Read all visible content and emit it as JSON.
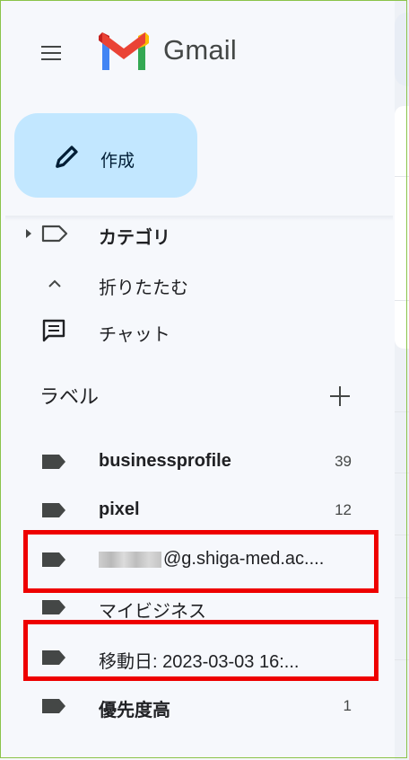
{
  "app": {
    "name": "Gmail"
  },
  "compose": {
    "label": "作成"
  },
  "nav": {
    "categories": "カテゴリ",
    "collapse": "折りたたむ",
    "chat": "チャット"
  },
  "labels_section": {
    "title": "ラベル"
  },
  "labels": [
    {
      "name": "businessprofile",
      "count": "39",
      "bold": true
    },
    {
      "name": "pixel",
      "count": "12",
      "bold": true
    },
    {
      "name": "@g.shiga-med.ac....",
      "count": "",
      "bold": false
    },
    {
      "name": "マイビジネス",
      "count": "",
      "bold": false
    },
    {
      "name": "移動日: 2023-03-03 16:...",
      "count": "",
      "bold": false
    },
    {
      "name": "優先度高",
      "count": "1",
      "bold": true
    }
  ],
  "icons": {
    "menu": "menu-icon",
    "compose": "pencil-icon",
    "category": "label-outline-icon",
    "collapse": "chevron-up-icon",
    "chat": "chat-icon",
    "label": "label-icon",
    "add": "plus-icon"
  },
  "colors": {
    "compose_bg": "#c2e7ff",
    "highlight_box": "#ee0000",
    "background": "#f6f8fc"
  }
}
